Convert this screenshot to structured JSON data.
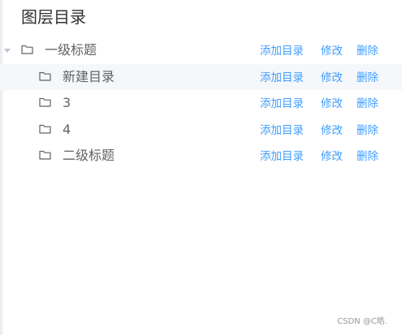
{
  "panel": {
    "title": "图层目录"
  },
  "tree": {
    "nodes": [
      {
        "label": "一级标题",
        "level": 1,
        "expanded": true,
        "highlighted": false
      },
      {
        "label": "新建目录",
        "level": 2,
        "expanded": false,
        "highlighted": true
      },
      {
        "label": "3",
        "level": 2,
        "expanded": false,
        "highlighted": false
      },
      {
        "label": "4",
        "level": 2,
        "expanded": false,
        "highlighted": false
      },
      {
        "label": "二级标题",
        "level": 2,
        "expanded": false,
        "highlighted": false
      }
    ],
    "actions": {
      "add": "添加目录",
      "edit": "修改",
      "delete": "删除"
    }
  },
  "colors": {
    "link": "#409eff",
    "text": "#606266",
    "title": "#303133",
    "highlight_bg": "#f5f7fa",
    "icon": "#606266"
  },
  "icons": {
    "expand": "caret-down-icon",
    "node": "folder-icon"
  },
  "watermark": "CSDN @C皓."
}
